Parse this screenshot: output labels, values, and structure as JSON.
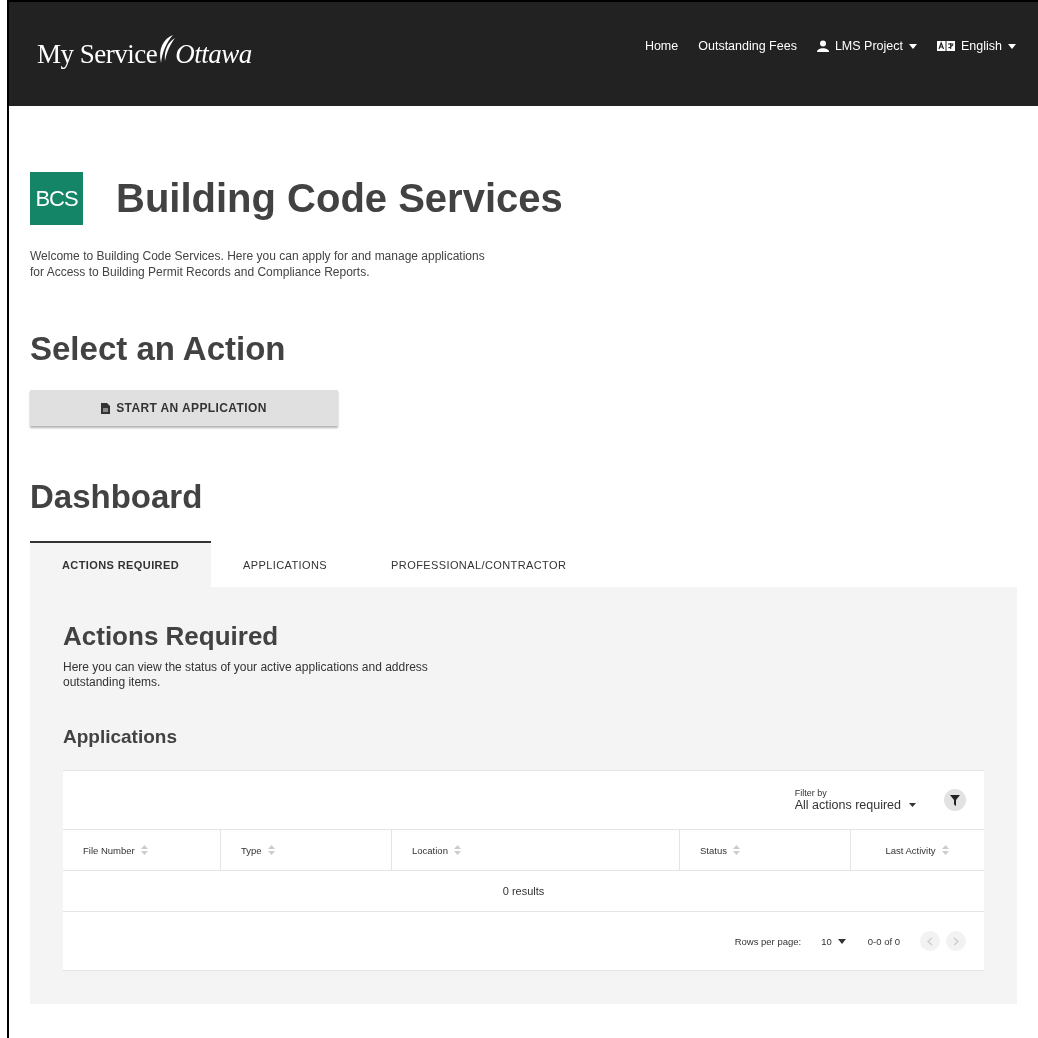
{
  "header": {
    "logo_left": "My Service",
    "logo_right": "Ottawa",
    "nav": [
      {
        "label": "Home",
        "kind": "link"
      },
      {
        "label": "Outstanding Fees",
        "kind": "link"
      },
      {
        "label": "LMS Project",
        "kind": "user"
      },
      {
        "label": "English",
        "kind": "language"
      }
    ]
  },
  "brand": {
    "badge": "BCS",
    "title": "Building Code Services",
    "intro": "Welcome to Building Code Services. Here you can apply for and manage applications for Access to Building Permit Records and Compliance Reports."
  },
  "actions": {
    "heading": "Select an Action",
    "button": "START AN APPLICATION"
  },
  "dashboard": {
    "heading": "Dashboard",
    "tabs": [
      {
        "label": "ACTIONS REQUIRED",
        "selected": true
      },
      {
        "label": "APPLICATIONS",
        "selected": false
      },
      {
        "label": "PROFESSIONAL/CONTRACTOR",
        "selected": false
      }
    ],
    "panel": {
      "heading": "Actions Required",
      "description": "Here you can view the status of your active applications and address outstanding items.",
      "subheading": "Applications",
      "filter": {
        "label": "Filter by",
        "value": "All actions required"
      },
      "table": {
        "columns": [
          "File Number",
          "Type",
          "Location",
          "Status",
          "Last Activity"
        ],
        "empty": "0 results"
      },
      "pagination": {
        "rows_label": "Rows per page:",
        "rows_value": "10",
        "range": "0-0 of 0"
      }
    }
  }
}
